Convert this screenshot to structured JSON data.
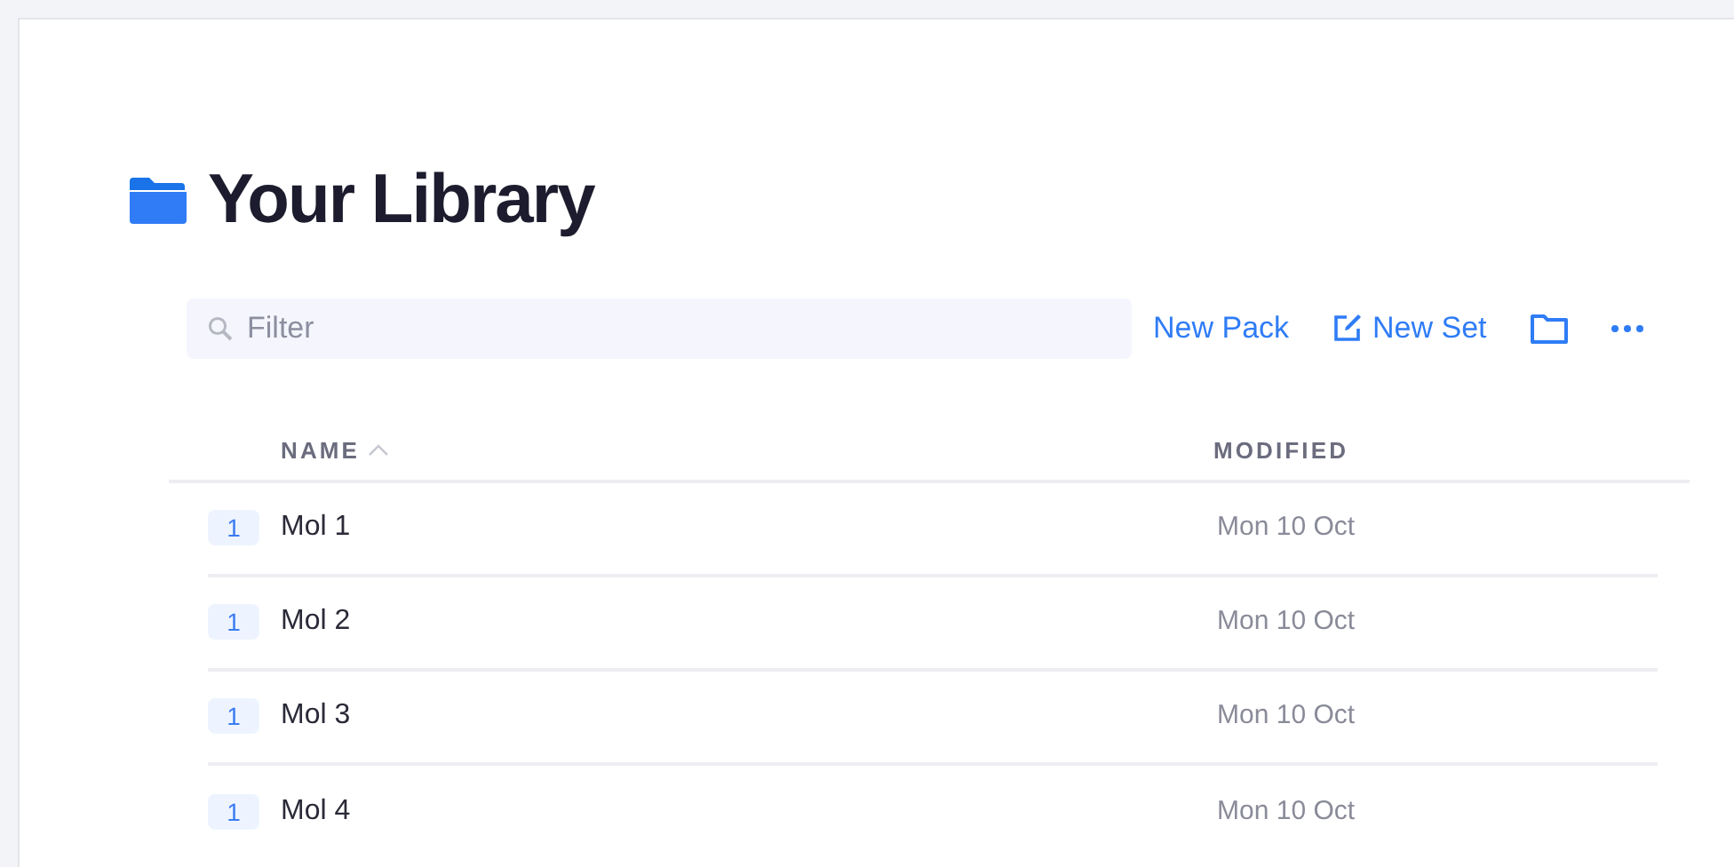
{
  "title": "Your Library",
  "filter": {
    "placeholder": "Filter"
  },
  "actions": [
    {
      "kind": "text",
      "label": "New Pack"
    },
    {
      "kind": "edit",
      "label": "New Set"
    },
    {
      "kind": "folder"
    },
    {
      "kind": "more"
    }
  ],
  "table": {
    "columns": [
      {
        "label": "NAME",
        "sorted": true
      },
      {
        "label": "MODIFIED",
        "sorted": false
      }
    ],
    "rows": [
      {
        "count": "1",
        "name": "Mol 1",
        "modified": "Mon 10 Oct"
      },
      {
        "count": "1",
        "name": "Mol 2",
        "modified": "Mon 10 Oct"
      },
      {
        "count": "1",
        "name": "Mol 3",
        "modified": "Mon 10 Oct"
      },
      {
        "count": "1",
        "name": "Mol 4",
        "modified": "Mon 10 Oct"
      }
    ]
  }
}
